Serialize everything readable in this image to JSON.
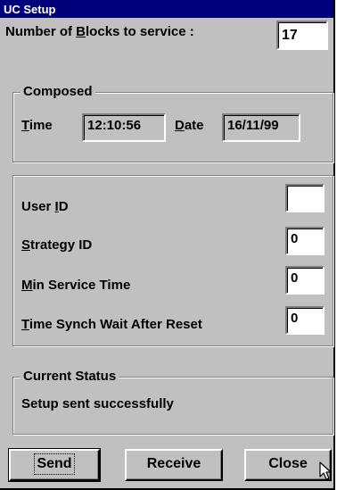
{
  "window": {
    "title": "UC Setup"
  },
  "blocks": {
    "label_pre": "Number of ",
    "label_accel": "B",
    "label_post": "locks to service :",
    "value": "17"
  },
  "composed": {
    "legend": "Composed",
    "time_accel": "T",
    "time_rest": "ime",
    "time_value": "12:10:56",
    "date_accel": "D",
    "date_rest": "ate",
    "date_value": "16/11/99"
  },
  "ids": {
    "user": {
      "pre": "User ",
      "accel": "I",
      "post": "D",
      "value": ""
    },
    "strategy": {
      "pre": "",
      "accel": "S",
      "post": "trategy ID",
      "value": "0"
    },
    "min_service": {
      "pre": "",
      "accel": "M",
      "post": "in Service Time",
      "value": "0"
    },
    "time_synch": {
      "pre": "",
      "accel": "T",
      "post": "ime Synch Wait After Reset",
      "value": "0"
    }
  },
  "status": {
    "legend": "Current Status",
    "text": "Setup sent successfully"
  },
  "buttons": {
    "send": "Send",
    "receive": "Receive",
    "close": "Close"
  },
  "colors": {
    "face": "#c0c0c0",
    "title_bar": "#00007b"
  },
  "icons": {
    "cursor": "arrow-pointer-icon"
  }
}
